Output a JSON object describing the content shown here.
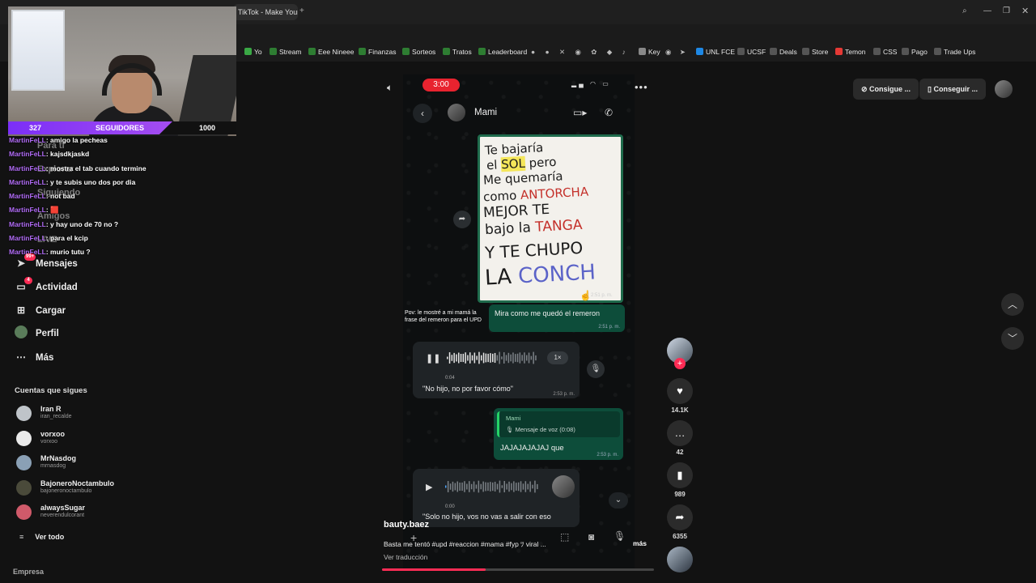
{
  "browser": {
    "tabs": [
      {
        "label": "TikTok - Make Your"
      }
    ],
    "bookmarks": [
      {
        "label": "Yo",
        "color": "#3aa845"
      },
      {
        "label": "Stream",
        "color": "#2e7d32"
      },
      {
        "label": "Eee Nineee",
        "color": "#2e7d32"
      },
      {
        "label": "Finanzas",
        "color": "#2e7d32"
      },
      {
        "label": "Sorteos",
        "color": "#2e7d32"
      },
      {
        "label": "Tratos",
        "color": "#2e7d32"
      },
      {
        "label": "Leaderboard",
        "color": "#2e7d32"
      },
      {
        "label": "Key",
        "color": "#888888"
      },
      {
        "label": "UNL FCE",
        "color": "#1e88e5"
      },
      {
        "label": "UCSF",
        "color": "#555555"
      },
      {
        "label": "Deals",
        "color": "#555555"
      },
      {
        "label": "Store",
        "color": "#555555"
      },
      {
        "label": "Temon",
        "color": "#e53935"
      },
      {
        "label": "CSS",
        "color": "#555555"
      },
      {
        "label": "Pago",
        "color": "#555555"
      },
      {
        "label": "Trade Ups",
        "color": "#555555"
      }
    ]
  },
  "stream": {
    "followers_current": "327",
    "followers_label": "SEGUIDORES",
    "followers_goal": "1000",
    "followers_progress": 0.327,
    "chat": [
      {
        "user": "MartinFeLL",
        "msg": ": amigo la pecheas"
      },
      {
        "user": "MartinFeLL",
        "msg": ": kajsdkjaskd"
      },
      {
        "user": "MartinFeLL",
        "msg": ": mostra el tab cuando termine"
      },
      {
        "user": "MartinFeLL",
        "msg": ": y te subis uno dos por dia"
      },
      {
        "user": "MartinFeLL",
        "msg": ": not bad"
      },
      {
        "user": "MartinFeLL",
        "msg": ": 🟥"
      },
      {
        "user": "MartinFeLL",
        "msg": ": y hay uno de 70 no ?"
      },
      {
        "user": "MartinFeLL",
        "msg": ": para el kcip"
      },
      {
        "user": "MartinFeLL",
        "msg": ": murio tutu ?"
      }
    ]
  },
  "sidebar": {
    "ghost_items": [
      "Para ti",
      "Explorar",
      "Siguiendo",
      "Amigos",
      "LIVE"
    ],
    "items": [
      {
        "label": "Mensajes",
        "icon": "paper-plane-icon",
        "badge": "99+"
      },
      {
        "label": "Actividad",
        "icon": "inbox-icon",
        "badge": "4"
      },
      {
        "label": "Cargar",
        "icon": "plus-square-icon",
        "badge": ""
      },
      {
        "label": "Perfil",
        "icon": "profile-icon",
        "badge": ""
      },
      {
        "label": "Más",
        "icon": "more-dots-icon",
        "badge": ""
      }
    ],
    "following_title": "Cuentas que sigues",
    "accounts": [
      {
        "name": "Iran R",
        "handle": "iran_recalde"
      },
      {
        "name": "vorxoo",
        "handle": "vorxoo"
      },
      {
        "name": "MrNasdog",
        "handle": "mrnasdog"
      },
      {
        "name": "BajoneroNoctambulo",
        "handle": "bajoneronoctambulo"
      },
      {
        "name": "alwaysSugar",
        "handle": "neverendulcorant"
      }
    ],
    "see_all": "Ver todo",
    "footer": "Empresa"
  },
  "video": {
    "clock": "3:00",
    "contact_name": "Mami",
    "sign": {
      "l1": "Te bajaría",
      "l2a": "el",
      "l2b": "SOL",
      "l2c": "pero",
      "l3": "Me quemaría",
      "l4a": "como",
      "l4b": "ANTORCHA",
      "l5a": "MEJOR TE",
      "l6a": "bajo la",
      "l6b": "TANGA",
      "l7": "Y TE CHUPO",
      "l8a": "LA",
      "l8b": "CONCH"
    },
    "photo_time": "2:51 p. m.",
    "overlay_caption": "Pov: le mostré a mi mamá la frase del remeron para el UPD",
    "msg_out": "Mira como me quedó el remeron",
    "msg_out_time": "2:51 p. m.",
    "voice1_speed": "1×",
    "voice1_duration": "0:04",
    "voice1_quote": "\"No hijo, no por favor cómo\"",
    "voice1_time": "2:53 p. m.",
    "reply_name": "Mami",
    "reply_voice": "Mensaje de voz (0:08)",
    "reply_text": "JAJAJAJAJAJ que",
    "reply_time": "2:53 p. m.",
    "voice2_duration": "0:00",
    "voice2_quote": "\"Solo no hijo, vos no vas a salir con eso",
    "author": "bauty.baez",
    "description": "Basta me tentó #upd #reaccion #mama #fyp ﾂ viral ...",
    "more": "más",
    "translate": "Ver traducción",
    "progress": 0.38
  },
  "actions": {
    "likes": "14.1K",
    "comments": "42",
    "saves": "989",
    "shares": "6355"
  },
  "topright": {
    "coins": "Consigue ...",
    "app": "Conseguir ..."
  },
  "colors": {
    "accent": "#fe2c55",
    "whatsapp_green": "#0d4d3a",
    "follower_bar": "#7b2ff7"
  }
}
